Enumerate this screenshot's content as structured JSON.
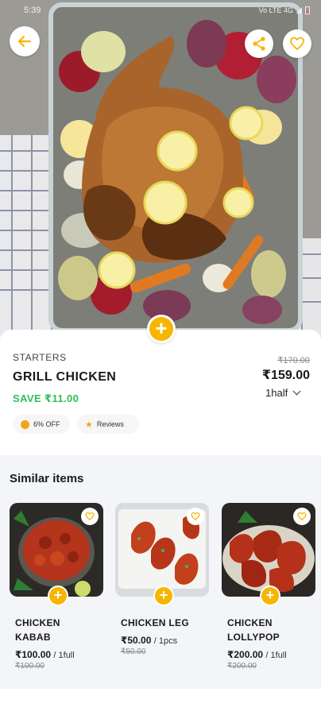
{
  "status_bar": {
    "time": "5:39",
    "icons_text": "Vo LTE 4G"
  },
  "hero": {
    "back_icon": "arrow-left-icon",
    "share_icon": "share-icon",
    "favorite_icon": "heart-outline-icon",
    "add_icon": "plus-icon"
  },
  "product": {
    "category": "STARTERS",
    "name": "GRILL CHICKEN",
    "save_text": "SAVE ₹11.00",
    "old_price": "₹170.00",
    "price": "₹159.00",
    "portion": "1half",
    "chips": {
      "discount": "6% OFF",
      "reviews": "Reviews"
    }
  },
  "similar": {
    "title": "Similar items",
    "items": [
      {
        "name_line1": "CHICKEN",
        "name_line2": "KABAB",
        "price": "₹100.00",
        "unit": "/ 1full",
        "old_price": "₹100.00"
      },
      {
        "name_line1": "CHICKEN LEG",
        "name_line2": "",
        "price": "₹50.00",
        "unit": "/ 1pcs",
        "old_price": "₹50.00"
      },
      {
        "name_line1": "CHICKEN",
        "name_line2": "LOLLYPOP",
        "price": "₹200.00",
        "unit": "/ 1full",
        "old_price": "₹200.00"
      }
    ]
  },
  "colors": {
    "accent": "#f7b500",
    "save_green": "#2dbf58",
    "section_bg": "#f3f5f9"
  }
}
